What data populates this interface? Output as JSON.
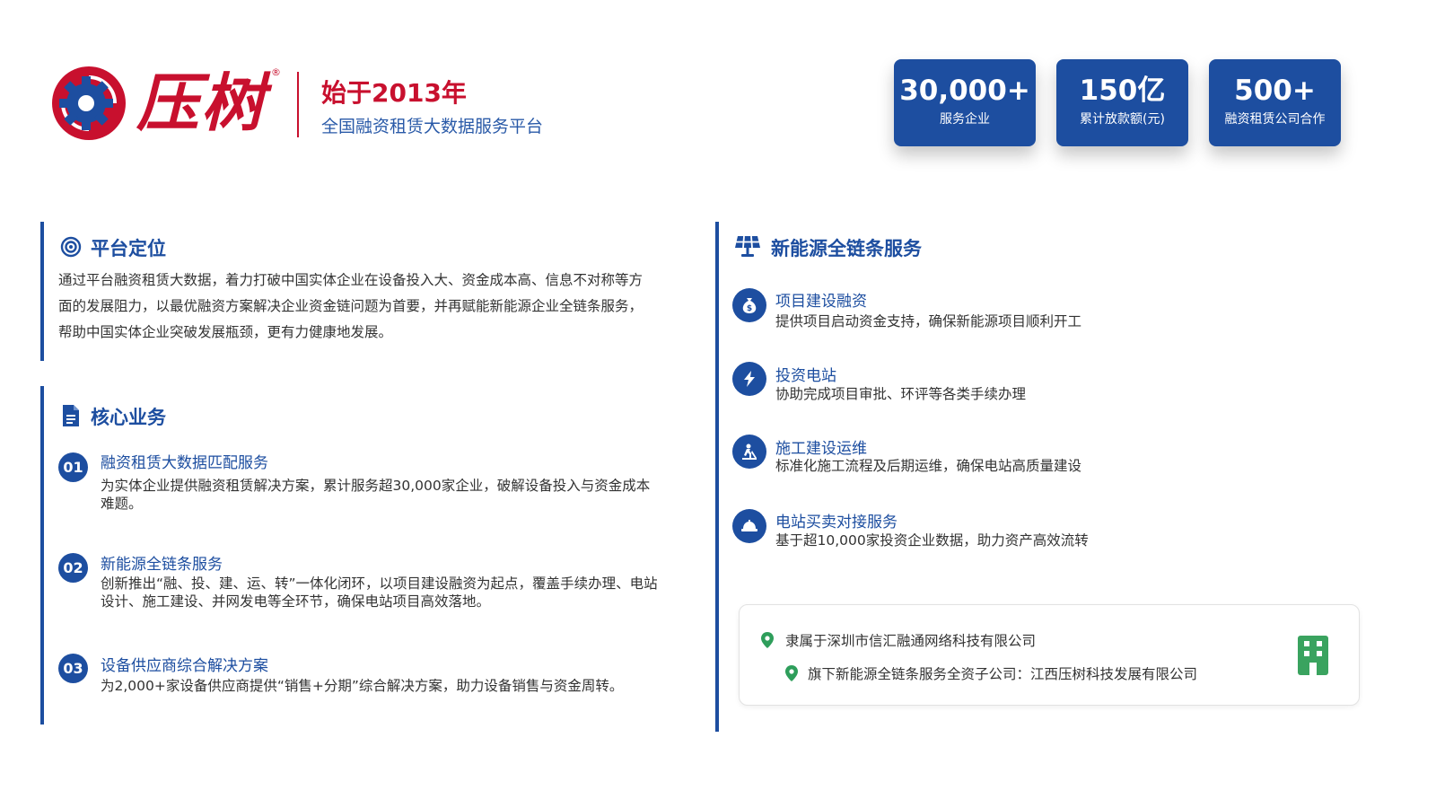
{
  "header": {
    "logo_text": "压树",
    "registered_mark": "®",
    "since": "始于2013年",
    "tagline": "全国融资租赁大数据服务平台"
  },
  "stats": [
    {
      "value": "30,000+",
      "label": "服务企业"
    },
    {
      "value": "150亿",
      "label": "累计放款额(元)"
    },
    {
      "value": "500+",
      "label": "融资租赁公司合作"
    }
  ],
  "positioning": {
    "title": "平台定位",
    "icon": "target-icon",
    "lines": [
      "通过平台融资租赁大数据，着力打破中国实体企业在设备投入大、资金成本高、信息不对称等方",
      "面的发展阻力，以最优融资方案解决企业资金链问题为首要，并再赋能新能源企业全链条服务，",
      "帮助中国实体企业突破发展瓶颈，更有力健康地发展。"
    ]
  },
  "core_business": {
    "title": "核心业务",
    "icon": "document-icon",
    "items": [
      {
        "num": "01",
        "title": "融资租赁大数据匹配服务",
        "lines": [
          "为实体企业提供融资租赁解决方案，累计服务超30,000家企业，破解设备投入与资金成本",
          "难题。"
        ]
      },
      {
        "num": "02",
        "title": "新能源全链条服务",
        "lines": [
          "创新推出“融、投、建、运、转”一体化闭环，以项目建设融资为起点，覆盖手续办理、电站",
          "设计、施工建设、并网发电等全环节，确保电站项目高效落地。"
        ]
      },
      {
        "num": "03",
        "title": "设备供应商综合解决方案",
        "lines": [
          "为2,000+家设备供应商提供“销售+分期”综合解决方案，助力设备销售与资金周转。"
        ]
      }
    ]
  },
  "new_energy": {
    "title": "新能源全链条服务",
    "icon": "solar-panel-icon",
    "items": [
      {
        "icon": "money-bag-icon",
        "title": "项目建设融资",
        "desc": "提供项目启动资金支持，确保新能源项目顺利开工"
      },
      {
        "icon": "lightning-icon",
        "title": "投资电站",
        "desc": "协助完成项目审批、环评等各类手续办理"
      },
      {
        "icon": "construction-icon",
        "title": "施工建设运维",
        "desc": "标准化施工流程及后期运维，确保电站高质量建设"
      },
      {
        "icon": "hard-hat-icon",
        "title": "电站买卖对接服务",
        "desc": "基于超10,000家投资企业数据，助力资产高效流转"
      }
    ]
  },
  "company_info": {
    "line1": "隶属于深圳市信汇融通网络科技有限公司",
    "line2": "旗下新能源全链条服务全资子公司：江西压树科技发展有限公司",
    "pin_icon": "location-pin-icon",
    "building_icon": "building-icon"
  },
  "colors": {
    "brand_red": "#c8102e",
    "brand_blue": "#1d4ea0",
    "pin_green": "#2e9e5b",
    "building_green": "#3aa35f"
  }
}
